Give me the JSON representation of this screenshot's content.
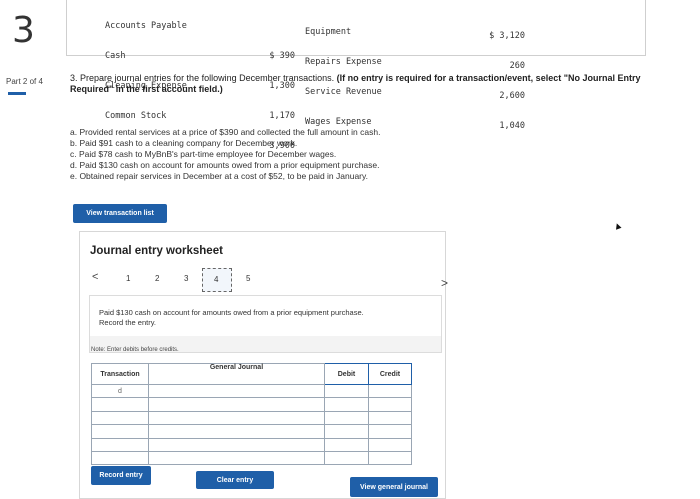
{
  "question_number": "3",
  "part": "Part 2 of 4",
  "accounts_left": [
    {
      "name": "Accounts Payable",
      "value": ""
    },
    {
      "name": "Cash",
      "value": "$ 390"
    },
    {
      "name": "Cleaning Expense",
      "value": "1,300"
    },
    {
      "name": "Common Stock",
      "value": "1,170"
    },
    {
      "name": "",
      "value": "3,900"
    }
  ],
  "accounts_right": [
    {
      "name": "Equipment",
      "value": "$ 3,120"
    },
    {
      "name": "Repairs Expense",
      "value": "260"
    },
    {
      "name": "Service Revenue",
      "value": "2,600"
    },
    {
      "name": "Wages Expense",
      "value": "1,040"
    }
  ],
  "question": {
    "text": "3. Prepare journal entries for the following December transactions. ",
    "instruction": "(If no entry is required for a transaction/event, select \"No Journal Entry Required\" in the first account field.)"
  },
  "transactions": [
    "a. Provided rental services at a price of $390 and collected the full amount in cash.",
    "b. Paid $91 cash to a cleaning company for December work.",
    "c. Paid $78 cash to MyBnB's part-time employee for December wages.",
    "d. Paid $130 cash on account for amounts owed from a prior equipment purchase.",
    "e. Obtained repair services in December at a cost of $52, to be paid in January."
  ],
  "view_transaction_list": "View transaction list",
  "worksheet": {
    "title": "Journal entry worksheet",
    "pages": [
      "1",
      "2",
      "3",
      "4",
      "5"
    ],
    "active_page": "4",
    "prev_arrow": "<",
    "next_arrow": ">",
    "description": "Paid $130 cash on account for amounts owed from a prior equipment purchase. Record the entry.",
    "note": "Note: Enter debits before credits.",
    "table": {
      "headers": {
        "transaction": "Transaction",
        "general_journal": "General Journal",
        "debit": "Debit",
        "credit": "Credit"
      },
      "rows": [
        {
          "transaction": "d"
        },
        {
          "transaction": ""
        },
        {
          "transaction": ""
        },
        {
          "transaction": ""
        },
        {
          "transaction": ""
        },
        {
          "transaction": ""
        }
      ]
    },
    "buttons": {
      "record": "Record entry",
      "clear": "Clear entry",
      "view_gj": "View general journal"
    }
  },
  "colors": {
    "accent": "#1f5fa8"
  }
}
